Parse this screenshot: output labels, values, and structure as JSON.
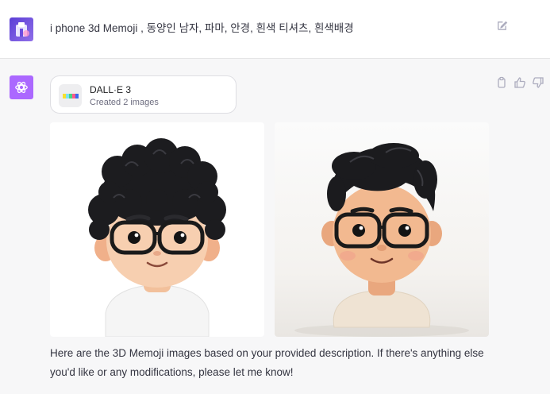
{
  "user": {
    "message": "i phone 3d Memoji , 동양인 남자, 파마, 안경, 흰색 티셔츠, 흰색배경",
    "avatar_icon": "user-avatar-icon",
    "edit_icon": "pencil-edit-icon"
  },
  "assistant": {
    "avatar_icon": "openai-logo-icon",
    "tool": {
      "name": "DALL·E 3",
      "status": "Created 2 images",
      "icon": "dalle-palette-icon"
    },
    "images": [
      {
        "alt": "3D Memoji with curly black perm hair and glasses, white t-shirt"
      },
      {
        "alt": "3D Memoji with wavy black hair and glasses, beige t-shirt"
      }
    ],
    "reply": "Here are the 3D Memoji images based on your provided description. If there's anything else you'd like or any modifications, please let me know!",
    "action_icons": [
      "copy-icon",
      "thumbs-up-icon",
      "thumbs-down-icon"
    ]
  },
  "colors": {
    "assistant_bg": "#f7f7f8",
    "bot_avatar": "#ab68ff",
    "user_avatar": "#6b4de0"
  }
}
